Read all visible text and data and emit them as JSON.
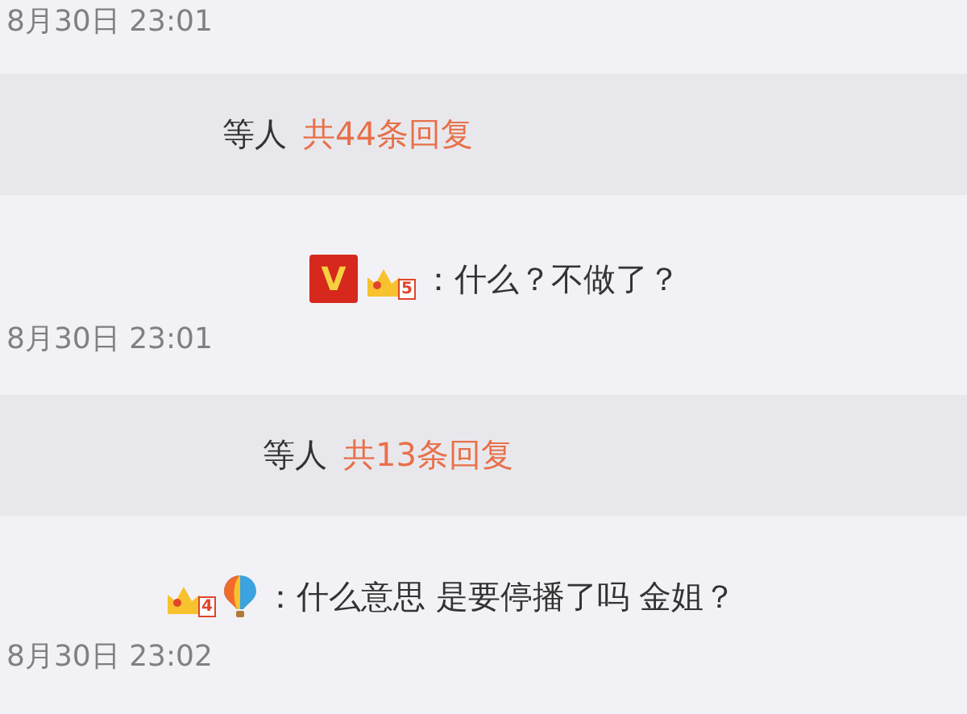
{
  "items": [
    {
      "kind": "timestamp",
      "text": "8月30日 23:01"
    },
    {
      "kind": "replies",
      "users": "等人",
      "count": "共44条回复"
    },
    {
      "kind": "comment",
      "badges": [
        {
          "kind": "vip",
          "text": "V"
        },
        {
          "kind": "crown",
          "text": "5"
        }
      ],
      "text": "：什么？不做了？"
    },
    {
      "kind": "timestamp",
      "text": "8月30日 23:01"
    },
    {
      "kind": "replies",
      "users": "等人",
      "count": "共13条回复"
    },
    {
      "kind": "comment",
      "badges": [
        {
          "kind": "crown",
          "text": "4"
        },
        {
          "kind": "balloon"
        }
      ],
      "text": "：什么意思 是要停播了吗 金姐？"
    },
    {
      "kind": "timestamp",
      "text": "8月30日 23:02"
    }
  ]
}
